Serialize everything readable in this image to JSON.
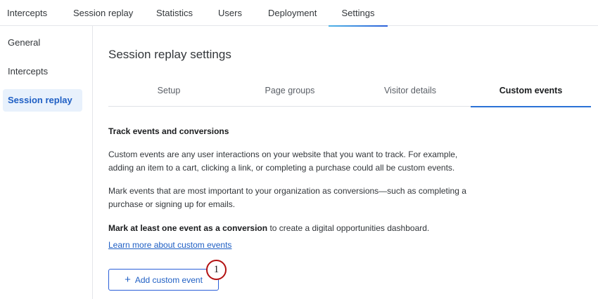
{
  "topnav": {
    "tabs": [
      {
        "label": "Intercepts"
      },
      {
        "label": "Session replay"
      },
      {
        "label": "Statistics"
      },
      {
        "label": "Users"
      },
      {
        "label": "Deployment"
      },
      {
        "label": "Settings",
        "active": true
      }
    ]
  },
  "sidebar": {
    "items": [
      {
        "label": "General"
      },
      {
        "label": "Intercepts"
      },
      {
        "label": "Session replay",
        "active": true
      }
    ]
  },
  "main": {
    "title": "Session replay settings",
    "subtabs": [
      {
        "label": "Setup"
      },
      {
        "label": "Page groups"
      },
      {
        "label": "Visitor details"
      },
      {
        "label": "Custom events",
        "active": true
      }
    ],
    "section_heading": "Track events and conversions",
    "paragraph_1": "Custom events are any user interactions on your website that you want to track. For example, adding an item to a cart, clicking a link, or completing a purchase could all be custom events.",
    "paragraph_2": "Mark events that are most important to your organization as conversions—such as completing a purchase or signing up for emails.",
    "paragraph_3_bold": "Mark at least one event as a conversion",
    "paragraph_3_rest": " to create a digital opportunities dashboard.",
    "learn_link": "Learn more about custom events",
    "add_button_icon": "+",
    "add_button_label": "Add custom event",
    "callout_number": "1"
  },
  "colors": {
    "accent": "#1f5fc4",
    "active_bg": "#e8f1fc",
    "callout_border": "#b31212"
  }
}
